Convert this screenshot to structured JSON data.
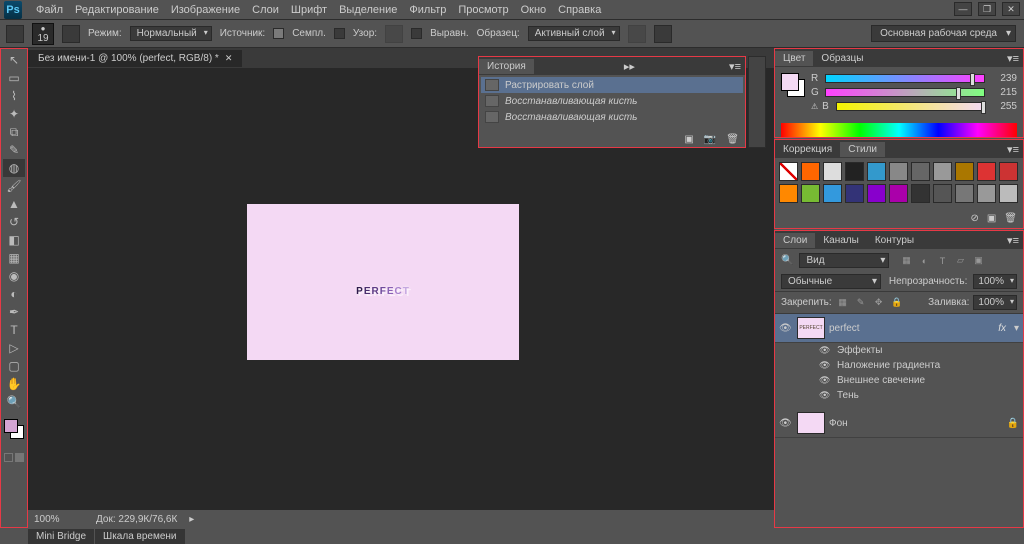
{
  "app": {
    "logo": "Ps"
  },
  "menu": [
    "Файл",
    "Редактирование",
    "Изображение",
    "Слои",
    "Шрифт",
    "Выделение",
    "Фильтр",
    "Просмотр",
    "Окно",
    "Справка"
  ],
  "optbar": {
    "brush_size": "19",
    "mode_label": "Режим:",
    "mode_value": "Нормальный",
    "source_label": "Источник:",
    "sample_label": "Семпл.",
    "pattern_label": "Узор:",
    "align_label": "Выравн.",
    "sample_label2": "Образец:",
    "sample_value": "Активный слой",
    "workspace": "Основная рабочая среда"
  },
  "doc": {
    "tab": "Без имени-1 @ 100% (perfect, RGB/8) *",
    "text_p": "P",
    "text_e": "E",
    "text_r": "R",
    "text_f": "F",
    "text_e2": "E",
    "text_c": "C",
    "text_t": "T",
    "zoom": "100%",
    "docsize": "Док: 229,9К/76,6К"
  },
  "bottom_tabs": [
    "Mini Bridge",
    "Шкала времени"
  ],
  "history": {
    "title": "История",
    "rows": [
      {
        "label": "Растрировать слой",
        "selected": true
      },
      {
        "label": "Восстанавливающая кисть",
        "dim": true
      },
      {
        "label": "Восстанавливающая кисть",
        "dim": true
      }
    ]
  },
  "color": {
    "tab1": "Цвет",
    "tab2": "Образцы",
    "r": "239",
    "g": "215",
    "b": "255",
    "r_lbl": "R",
    "g_lbl": "G",
    "b_lbl": "B"
  },
  "styles": {
    "tab1": "Коррекция",
    "tab2": "Стили",
    "swatches": [
      "#fff",
      "#f60",
      "#ddd",
      "#222",
      "#39c",
      "#888",
      "#666",
      "#999",
      "#a70",
      "#d33",
      "#c33",
      "#f80",
      "#7b3",
      "#39d",
      "#337",
      "#80c",
      "#a0a",
      "#333",
      "#555",
      "#777",
      "#999",
      "#bbb"
    ]
  },
  "layers": {
    "tab1": "Слои",
    "tab2": "Каналы",
    "tab3": "Контуры",
    "kind": "Вид",
    "blend": "Обычные",
    "opacity_label": "Непрозрачность:",
    "opacity": "100%",
    "lock_label": "Закрепить:",
    "fill_label": "Заливка:",
    "fill": "100%",
    "layer1": "perfect",
    "fx": "fx",
    "fx_title": "Эффекты",
    "fx1": "Наложение градиента",
    "fx2": "Внешнее свечение",
    "fx3": "Тень",
    "layer2": "Фон"
  }
}
